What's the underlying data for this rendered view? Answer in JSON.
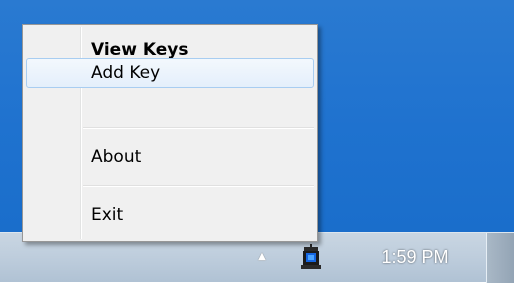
{
  "context_menu": {
    "items": [
      {
        "label": "View Keys"
      },
      {
        "label": "Add Key"
      },
      {
        "label": "About"
      },
      {
        "label": "Exit"
      }
    ]
  },
  "taskbar": {
    "clock": "1:59 PM",
    "tray_arrow_icon": "show-hidden-icons-arrow",
    "app_icon": "key-manager-tray-icon"
  },
  "colors": {
    "desktop": "#1f72cf",
    "taskbar": "#bfcedd",
    "menu_bg": "#f0f0f0",
    "hover_border": "#a8cdf1"
  }
}
